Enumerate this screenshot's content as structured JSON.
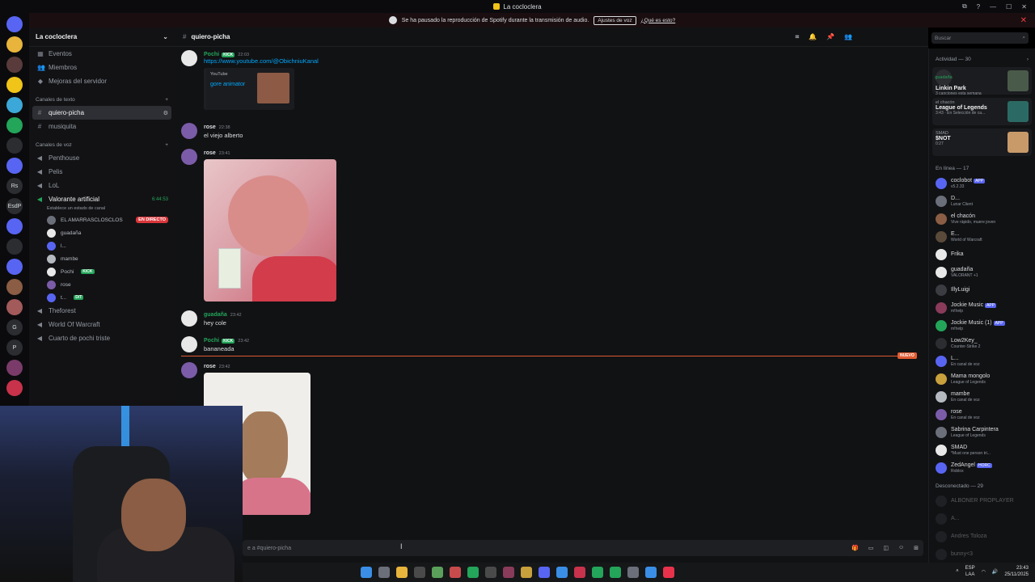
{
  "window": {
    "title": "La cocloclera",
    "controls": [
      "⧉",
      "?",
      "—",
      "☐",
      "✕"
    ]
  },
  "banner": {
    "text": "Se ha pausado la reproducción de Spotify durante la transmisión de audio.",
    "button": "Ajustes de voz",
    "link": "¿Qué es esto?"
  },
  "guilds": [
    "",
    "",
    "",
    "",
    "",
    "",
    "",
    "",
    "Rs",
    "EsdP",
    "",
    "",
    "",
    "",
    "",
    "G",
    "P",
    "",
    ""
  ],
  "sidebar": {
    "server_name": "La cocloclera",
    "items": [
      {
        "icon": "calendar-icon",
        "glyph": "▦",
        "label": "Eventos"
      },
      {
        "icon": "members-icon",
        "glyph": "👥",
        "label": "Miembros"
      },
      {
        "icon": "boost-icon",
        "glyph": "◆",
        "label": "Mejoras del servidor"
      }
    ],
    "text_category": "Canales de texto",
    "text_channels": [
      {
        "label": "quiero-picha",
        "active": true
      },
      {
        "label": "musiquita",
        "active": false
      }
    ],
    "voice_category": "Canales de voz",
    "voice_channels": [
      {
        "label": "Penthouse"
      },
      {
        "label": "Pelis"
      },
      {
        "label": "LoL"
      }
    ],
    "active_voice": {
      "label": "Valorante artificial",
      "timer": "6:44:53",
      "status": "Establece un estado de canal",
      "users": [
        {
          "name": "EL AMARRASCLOSCLOS",
          "live": "EN DIRECTO"
        },
        {
          "name": "guadaña"
        },
        {
          "name": "l..."
        },
        {
          "name": "mambe"
        },
        {
          "name": "Pochi",
          "badge": "KICK"
        },
        {
          "name": "rose"
        },
        {
          "name": "t...",
          "badge": "D/T"
        }
      ]
    },
    "more_channels": [
      {
        "label": "Theforest"
      },
      {
        "label": "World Of Warcraft"
      },
      {
        "label": "Cuarto de pochi triste"
      }
    ]
  },
  "channel": {
    "name": "quiero-picha",
    "search_placeholder": "Buscar",
    "composer_placeholder": "e a #quiero-picha"
  },
  "messages": [
    {
      "author": "Pochi",
      "badge": "KICK",
      "time": "22:03",
      "link": "https://www.youtube.com/@ObichniuKanal",
      "embed_source": "YouTube",
      "embed_title": "gore animator",
      "color": "#23a55a"
    },
    {
      "author": "rose",
      "time": "22:38",
      "text": "el viejo alberto",
      "color": "#dbdee1"
    },
    {
      "author": "rose",
      "time": "23:41",
      "color": "#dbdee1"
    },
    {
      "author": "guadaña",
      "time": "23:42",
      "text": "hey cole",
      "color": "#23a55a"
    },
    {
      "author": "Pochi",
      "badge": "KICK",
      "time": "23:42",
      "text": "bananeada",
      "color": "#23a55a"
    },
    {
      "author": "rose",
      "time": "23:42",
      "color": "#dbdee1"
    }
  ],
  "new_label": "NUEVO",
  "members": {
    "activity_header": "Actividad — 30",
    "activities": [
      {
        "user": "guadaña",
        "game": "Linkin Park",
        "sub": "3 canciones esta semana",
        "user_color": "green"
      },
      {
        "user": "el chacón",
        "game": "League of Legends",
        "sub": "3:43 · En Selección de ca...",
        "user_color": "gray"
      },
      {
        "user": "SMAD",
        "game": "$NOT",
        "sub": "0:27",
        "user_color": "gray"
      }
    ],
    "online_header": "En línea — 17",
    "online": [
      {
        "name": "coclobot",
        "status": "v5.2.33",
        "app": "APP"
      },
      {
        "name": "D...",
        "status": "Lunar Client"
      },
      {
        "name": "el chacón",
        "status": "Vive rápido, muere joven"
      },
      {
        "name": "E...",
        "status": "World of Warcraft"
      },
      {
        "name": "Frika",
        "status": ""
      },
      {
        "name": "guadaña",
        "status": "VALORANT +1"
      },
      {
        "name": "IllyLuigi",
        "status": ""
      },
      {
        "name": "Jockie Music",
        "status": "m!help",
        "app": "APP"
      },
      {
        "name": "Jockie Music (1)",
        "status": "m!help",
        "app": "APP"
      },
      {
        "name": "Low2Key_",
        "status": "Counter-Strike 2"
      },
      {
        "name": "L...",
        "status": "En canal de voz"
      },
      {
        "name": "Mama mongolo",
        "status": "League of Legends"
      },
      {
        "name": "mambe",
        "status": "En canal de voz"
      },
      {
        "name": "rose",
        "status": "En canal de voz"
      },
      {
        "name": "Sabrina Carpintera",
        "status": "League of Legends"
      },
      {
        "name": "SMAD",
        "status": "*Must one person tri..."
      },
      {
        "name": "ZedAngel",
        "status": "Roblox",
        "badge": "HORC"
      }
    ],
    "offline_header": "Desconectado — 29",
    "offline": [
      {
        "name": "ALBONER PROPLAYER"
      },
      {
        "name": "A..."
      },
      {
        "name": "Andres Toloza"
      },
      {
        "name": "bunny<3"
      }
    ]
  },
  "taskbar": {
    "lang": "ESP",
    "lang_sub": "LAA",
    "time": "23:43",
    "date": "25/11/2025"
  }
}
